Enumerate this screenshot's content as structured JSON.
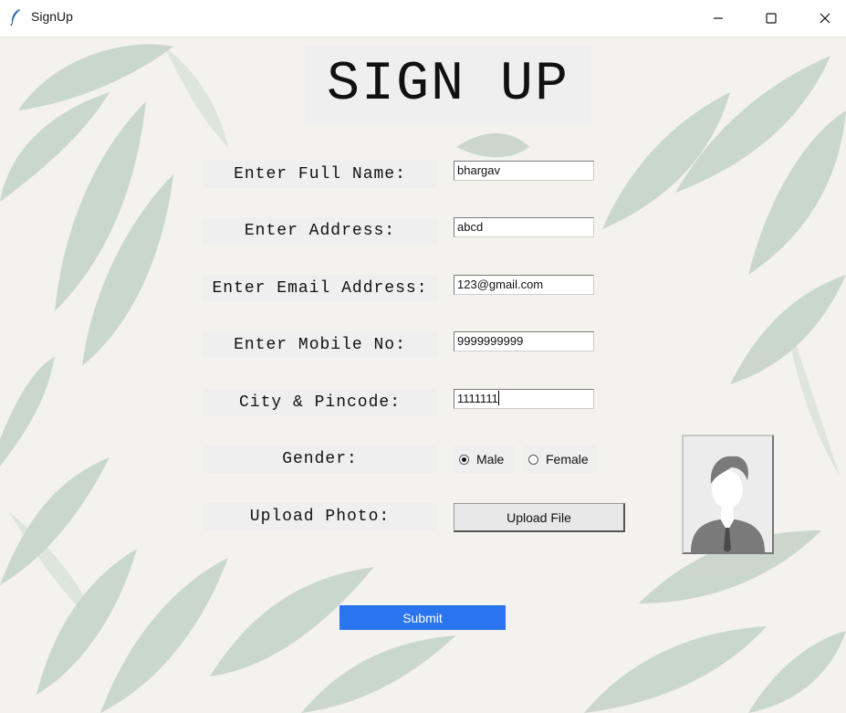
{
  "window": {
    "title": "SignUp"
  },
  "heading": "SIGN UP",
  "fields": [
    {
      "label": "Enter Full Name:",
      "value": "bhargav"
    },
    {
      "label": "Enter Address:",
      "value": "abcd"
    },
    {
      "label": "Enter Email Address:",
      "value": "123@gmail.com"
    },
    {
      "label": "Enter Mobile No:",
      "value": "9999999999"
    },
    {
      "label": "City & Pincode:",
      "value": "1111111"
    }
  ],
  "gender": {
    "label": "Gender:",
    "options": [
      "Male",
      "Female"
    ],
    "selected": "Male"
  },
  "upload": {
    "label": "Upload Photo:",
    "button": "Upload File"
  },
  "submit": "Submit",
  "colors": {
    "submit_bg": "#2a74f0",
    "label_bg": "#efefef",
    "page_bg": "#f3f2ee"
  }
}
